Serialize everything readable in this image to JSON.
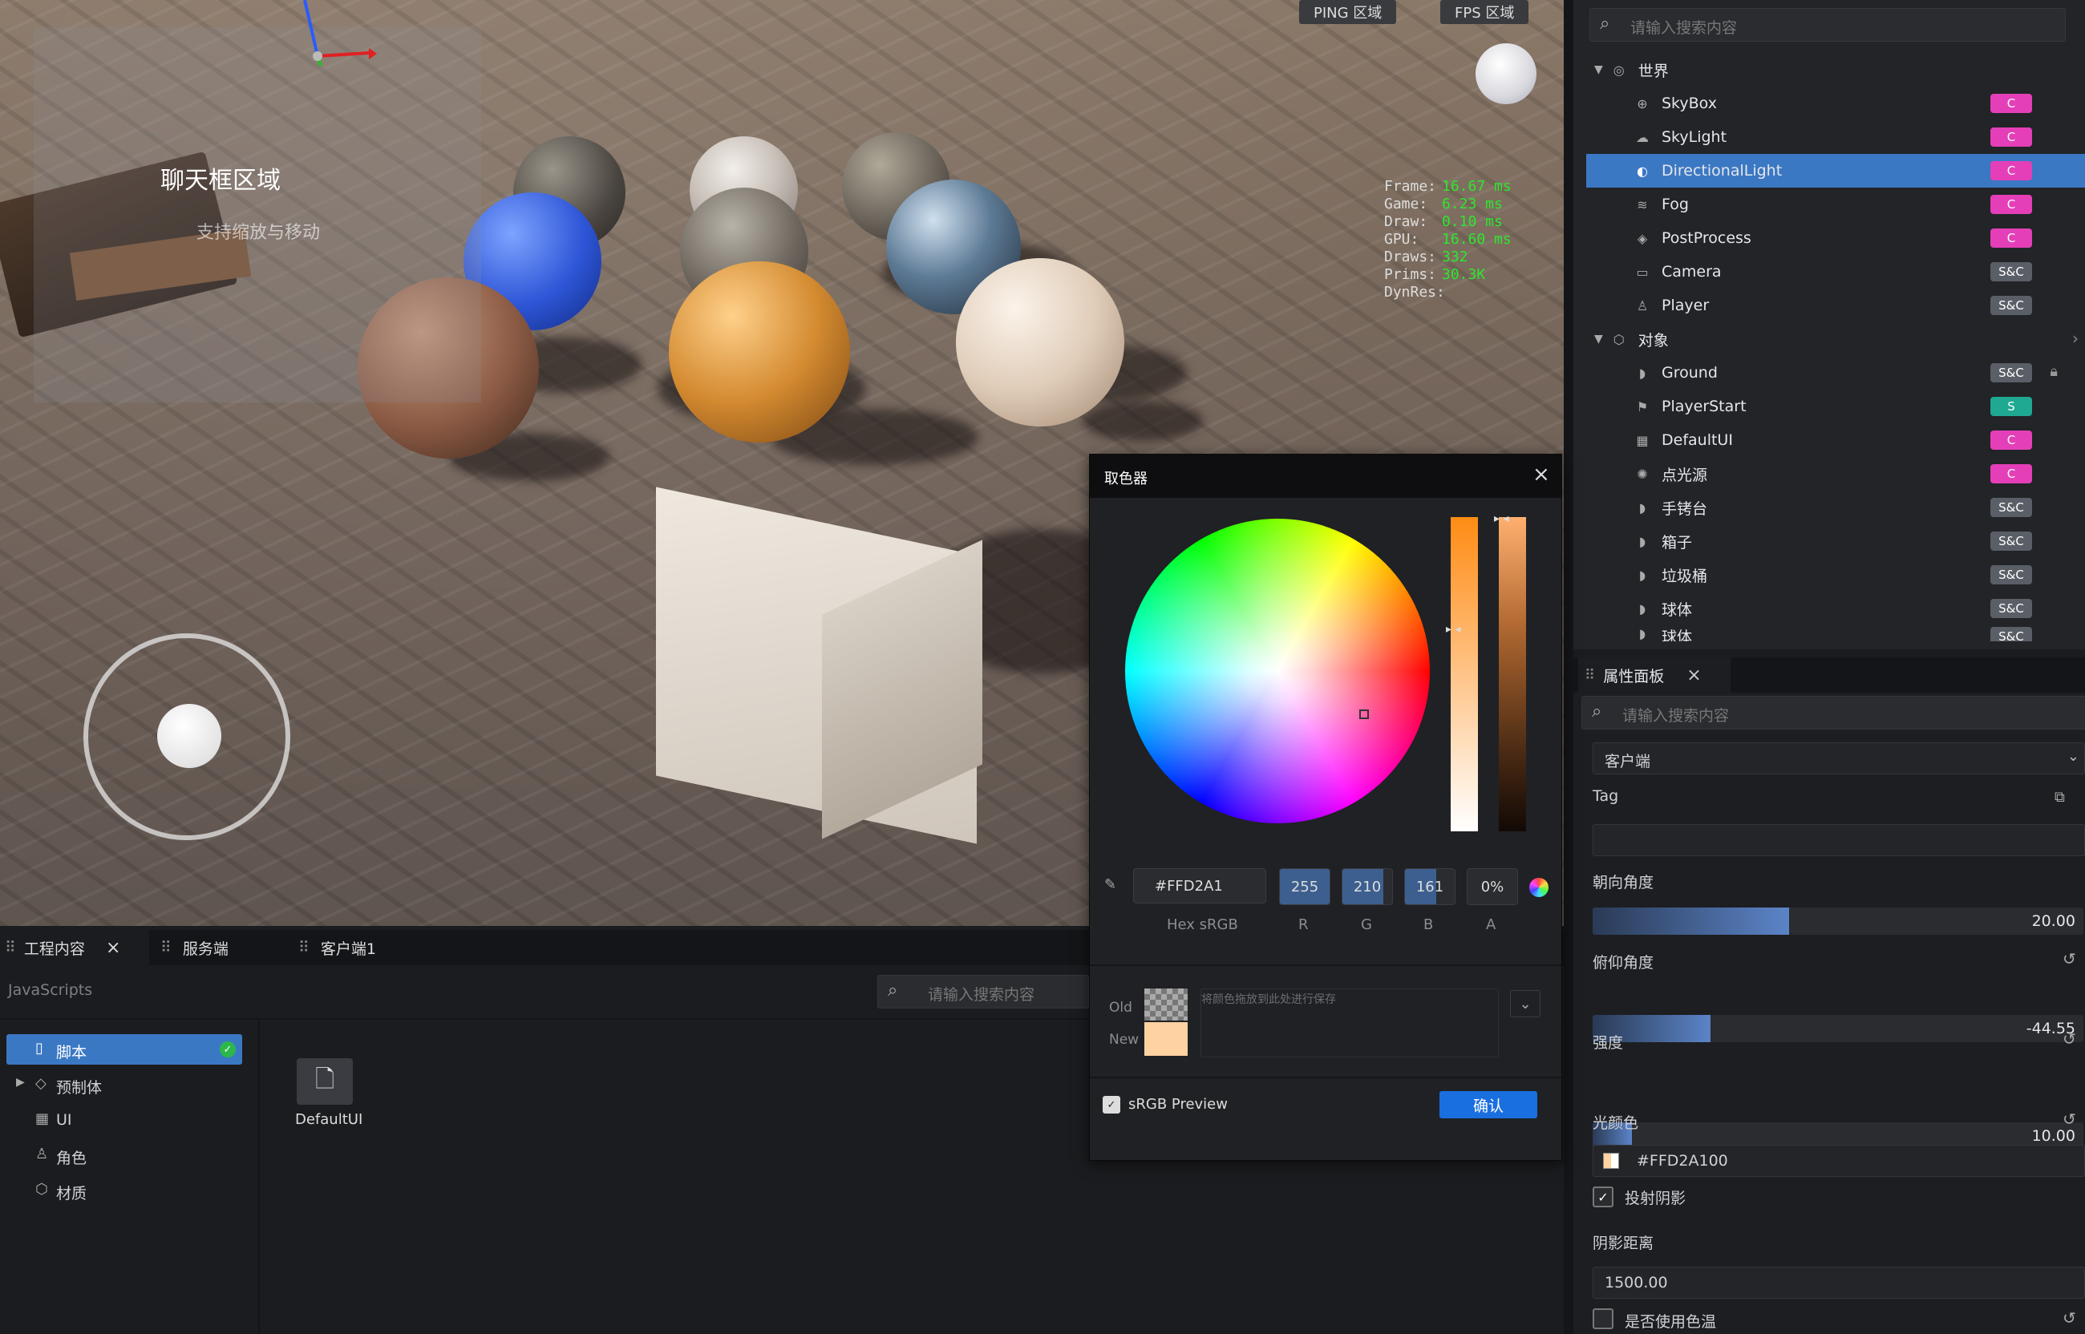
{
  "viewport": {
    "ping_label": "PING 区域",
    "fps_label": "FPS 区域",
    "chat_title": "聊天框区域",
    "chat_subtitle": "支持缩放与移动",
    "stats": [
      {
        "k": "Frame:",
        "v": "16.67 ms"
      },
      {
        "k": "Game:",
        "v": "6.23 ms"
      },
      {
        "k": "Draw:",
        "v": "0.10 ms"
      },
      {
        "k": "GPU:",
        "v": "16.60 ms"
      },
      {
        "k": "Draws:",
        "v": "332"
      },
      {
        "k": "Prims:",
        "v": "30.3K"
      },
      {
        "k": "DynRes:",
        "v": ""
      }
    ]
  },
  "world": {
    "search_placeholder": "请输入搜索内容",
    "group_world": "世界",
    "group_objects": "对象",
    "items": [
      {
        "label": "SkyBox",
        "badge": "C",
        "kind": "c",
        "icon": "globe-icon"
      },
      {
        "label": "SkyLight",
        "badge": "C",
        "kind": "c",
        "icon": "cloud-icon"
      },
      {
        "label": "DirectionalLight",
        "badge": "C",
        "kind": "c",
        "icon": "light-icon",
        "selected": true
      },
      {
        "label": "Fog",
        "badge": "C",
        "kind": "c",
        "icon": "fog-icon"
      },
      {
        "label": "PostProcess",
        "badge": "C",
        "kind": "c",
        "icon": "postprocess-icon"
      },
      {
        "label": "Camera",
        "badge": "S&C",
        "kind": "sc",
        "icon": "camera-icon"
      },
      {
        "label": "Player",
        "badge": "S&C",
        "kind": "sc",
        "icon": "player-icon"
      }
    ],
    "objects": [
      {
        "label": "Ground",
        "badge": "S&C",
        "kind": "sc",
        "icon": "mesh-icon",
        "locked": true
      },
      {
        "label": "PlayerStart",
        "badge": "S",
        "kind": "s",
        "icon": "flag-icon"
      },
      {
        "label": "DefaultUI",
        "badge": "C",
        "kind": "c",
        "icon": "ui-icon"
      },
      {
        "label": "点光源",
        "badge": "C",
        "kind": "c",
        "icon": "pointlight-icon"
      },
      {
        "label": "手铐台",
        "badge": "S&C",
        "kind": "sc",
        "icon": "mesh-icon"
      },
      {
        "label": "箱子",
        "badge": "S&C",
        "kind": "sc",
        "icon": "mesh-icon"
      },
      {
        "label": "垃圾桶",
        "badge": "S&C",
        "kind": "sc",
        "icon": "mesh-icon"
      },
      {
        "label": "球体",
        "badge": "S&C",
        "kind": "sc",
        "icon": "mesh-icon"
      },
      {
        "label": "球体",
        "badge": "S&C",
        "kind": "sc",
        "icon": "mesh-icon"
      }
    ]
  },
  "properties": {
    "title": "属性面板",
    "search_placeholder": "请输入搜索内容",
    "net_value": "客户端",
    "tag_label": "Tag",
    "yaw_label": "朝向角度",
    "yaw_value": "20.00",
    "yaw_fraction": 0.4,
    "pitch_label": "俯仰角度",
    "pitch_value": "-44.55",
    "pitch_fraction": 0.24,
    "intensity_label": "强度",
    "intensity_value": "10.00",
    "intensity_fraction": 0.08,
    "color_label": "光颜色",
    "color_value": "#FFD2A100",
    "cast_shadow_label": "投射阴影",
    "shadow_dist_label": "阴影距离",
    "shadow_dist_value": "1500.00",
    "use_temp_label": "是否使用色温"
  },
  "bottom": {
    "tabs": [
      "工程内容",
      "服务端",
      "客户端1"
    ],
    "breadcrumb": "JavaScripts",
    "search_placeholder": "请输入搜索内容",
    "tree": [
      "脚本",
      "预制体",
      "UI",
      "角色",
      "材质"
    ],
    "file_label": "DefaultUI"
  },
  "picker": {
    "title": "取色器",
    "hex": "#FFD2A1",
    "r": "255",
    "g": "210",
    "b": "161",
    "a": "0%",
    "hex_label": "Hex sRGB",
    "r_label": "R",
    "g_label": "G",
    "b_label": "B",
    "a_label": "A",
    "old_label": "Old",
    "new_label": "New",
    "save_hint": "将颜色拖放到此处进行保存",
    "srgb_label": "sRGB Preview",
    "confirm": "确认",
    "new_color": "#FFD2A1"
  },
  "colors": {
    "accent": "#3b78c4",
    "badge_c": "#e43fb8",
    "badge_sc": "#5a5e66",
    "badge_s": "#1fa892"
  }
}
